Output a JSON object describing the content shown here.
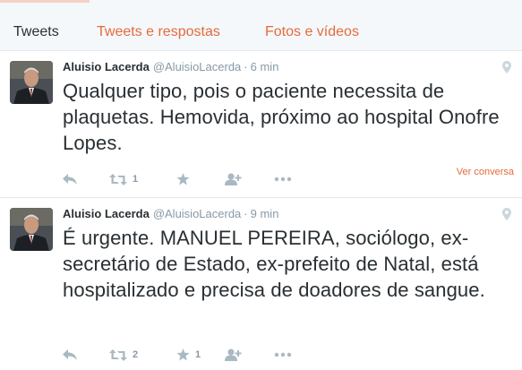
{
  "tabs": {
    "tweets": "Tweets",
    "tweets_replies": "Tweets e respostas",
    "photos_videos": "Fotos e vídeos"
  },
  "colors": {
    "accent": "#e36b3d",
    "muted": "#8899a6",
    "text": "#292f33"
  },
  "tweets": [
    {
      "fullname": "Aluisio Lacerda",
      "username": "@AluisioLacerda",
      "separator": "·",
      "time": "6 min",
      "text": "Qualquer tipo, pois o paciente necessita de plaquetas. Hemovida, próximo ao hospital Onofre Lopes.",
      "view_conversation": "Ver conversa",
      "retweets": "1",
      "favorites": ""
    },
    {
      "fullname": "Aluisio Lacerda",
      "username": "@AluisioLacerda",
      "separator": "·",
      "time": "9 min",
      "text": "É urgente. MANUEL PEREIRA, sociólogo, ex-secretário de Estado, ex-prefeito de Natal, está hospitalizado e precisa de doadores de sangue.",
      "retweets": "2",
      "favorites": "1"
    }
  ],
  "icons": [
    "reply-icon",
    "retweet-icon",
    "favorite-icon",
    "follow-icon",
    "more-icon",
    "geo-pin-icon"
  ]
}
